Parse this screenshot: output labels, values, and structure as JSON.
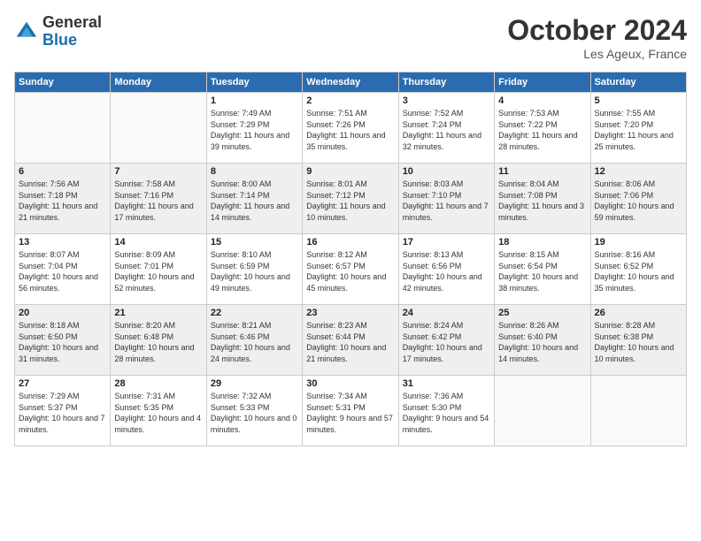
{
  "header": {
    "logo_general": "General",
    "logo_blue": "Blue",
    "month_title": "October 2024",
    "location": "Les Ageux, France"
  },
  "weekdays": [
    "Sunday",
    "Monday",
    "Tuesday",
    "Wednesday",
    "Thursday",
    "Friday",
    "Saturday"
  ],
  "weeks": [
    [
      {
        "day": "",
        "info": ""
      },
      {
        "day": "",
        "info": ""
      },
      {
        "day": "1",
        "info": "Sunrise: 7:49 AM\nSunset: 7:29 PM\nDaylight: 11 hours and 39 minutes."
      },
      {
        "day": "2",
        "info": "Sunrise: 7:51 AM\nSunset: 7:26 PM\nDaylight: 11 hours and 35 minutes."
      },
      {
        "day": "3",
        "info": "Sunrise: 7:52 AM\nSunset: 7:24 PM\nDaylight: 11 hours and 32 minutes."
      },
      {
        "day": "4",
        "info": "Sunrise: 7:53 AM\nSunset: 7:22 PM\nDaylight: 11 hours and 28 minutes."
      },
      {
        "day": "5",
        "info": "Sunrise: 7:55 AM\nSunset: 7:20 PM\nDaylight: 11 hours and 25 minutes."
      }
    ],
    [
      {
        "day": "6",
        "info": "Sunrise: 7:56 AM\nSunset: 7:18 PM\nDaylight: 11 hours and 21 minutes."
      },
      {
        "day": "7",
        "info": "Sunrise: 7:58 AM\nSunset: 7:16 PM\nDaylight: 11 hours and 17 minutes."
      },
      {
        "day": "8",
        "info": "Sunrise: 8:00 AM\nSunset: 7:14 PM\nDaylight: 11 hours and 14 minutes."
      },
      {
        "day": "9",
        "info": "Sunrise: 8:01 AM\nSunset: 7:12 PM\nDaylight: 11 hours and 10 minutes."
      },
      {
        "day": "10",
        "info": "Sunrise: 8:03 AM\nSunset: 7:10 PM\nDaylight: 11 hours and 7 minutes."
      },
      {
        "day": "11",
        "info": "Sunrise: 8:04 AM\nSunset: 7:08 PM\nDaylight: 11 hours and 3 minutes."
      },
      {
        "day": "12",
        "info": "Sunrise: 8:06 AM\nSunset: 7:06 PM\nDaylight: 10 hours and 59 minutes."
      }
    ],
    [
      {
        "day": "13",
        "info": "Sunrise: 8:07 AM\nSunset: 7:04 PM\nDaylight: 10 hours and 56 minutes."
      },
      {
        "day": "14",
        "info": "Sunrise: 8:09 AM\nSunset: 7:01 PM\nDaylight: 10 hours and 52 minutes."
      },
      {
        "day": "15",
        "info": "Sunrise: 8:10 AM\nSunset: 6:59 PM\nDaylight: 10 hours and 49 minutes."
      },
      {
        "day": "16",
        "info": "Sunrise: 8:12 AM\nSunset: 6:57 PM\nDaylight: 10 hours and 45 minutes."
      },
      {
        "day": "17",
        "info": "Sunrise: 8:13 AM\nSunset: 6:56 PM\nDaylight: 10 hours and 42 minutes."
      },
      {
        "day": "18",
        "info": "Sunrise: 8:15 AM\nSunset: 6:54 PM\nDaylight: 10 hours and 38 minutes."
      },
      {
        "day": "19",
        "info": "Sunrise: 8:16 AM\nSunset: 6:52 PM\nDaylight: 10 hours and 35 minutes."
      }
    ],
    [
      {
        "day": "20",
        "info": "Sunrise: 8:18 AM\nSunset: 6:50 PM\nDaylight: 10 hours and 31 minutes."
      },
      {
        "day": "21",
        "info": "Sunrise: 8:20 AM\nSunset: 6:48 PM\nDaylight: 10 hours and 28 minutes."
      },
      {
        "day": "22",
        "info": "Sunrise: 8:21 AM\nSunset: 6:46 PM\nDaylight: 10 hours and 24 minutes."
      },
      {
        "day": "23",
        "info": "Sunrise: 8:23 AM\nSunset: 6:44 PM\nDaylight: 10 hours and 21 minutes."
      },
      {
        "day": "24",
        "info": "Sunrise: 8:24 AM\nSunset: 6:42 PM\nDaylight: 10 hours and 17 minutes."
      },
      {
        "day": "25",
        "info": "Sunrise: 8:26 AM\nSunset: 6:40 PM\nDaylight: 10 hours and 14 minutes."
      },
      {
        "day": "26",
        "info": "Sunrise: 8:28 AM\nSunset: 6:38 PM\nDaylight: 10 hours and 10 minutes."
      }
    ],
    [
      {
        "day": "27",
        "info": "Sunrise: 7:29 AM\nSunset: 5:37 PM\nDaylight: 10 hours and 7 minutes."
      },
      {
        "day": "28",
        "info": "Sunrise: 7:31 AM\nSunset: 5:35 PM\nDaylight: 10 hours and 4 minutes."
      },
      {
        "day": "29",
        "info": "Sunrise: 7:32 AM\nSunset: 5:33 PM\nDaylight: 10 hours and 0 minutes."
      },
      {
        "day": "30",
        "info": "Sunrise: 7:34 AM\nSunset: 5:31 PM\nDaylight: 9 hours and 57 minutes."
      },
      {
        "day": "31",
        "info": "Sunrise: 7:36 AM\nSunset: 5:30 PM\nDaylight: 9 hours and 54 minutes."
      },
      {
        "day": "",
        "info": ""
      },
      {
        "day": "",
        "info": ""
      }
    ]
  ]
}
